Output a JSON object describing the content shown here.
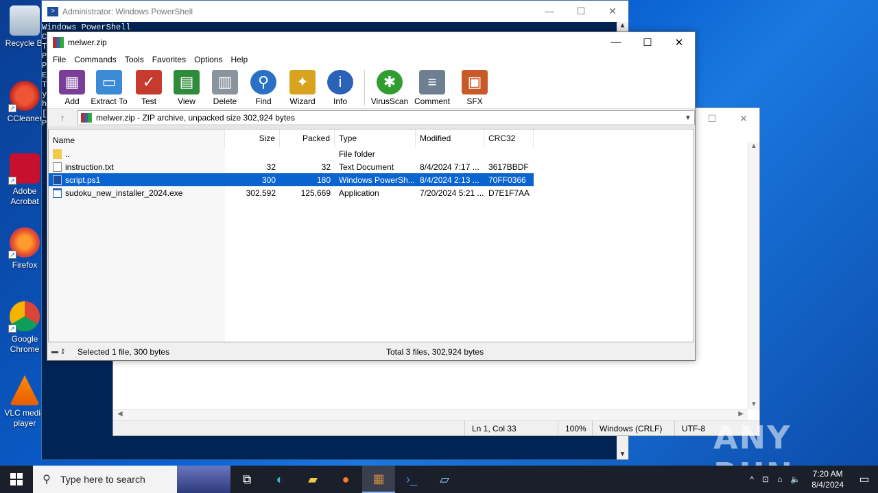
{
  "desktop": {
    "icons": [
      {
        "label": "Recycle Bi",
        "icon": "recycle-bin-icon"
      },
      {
        "label": "CCleaner",
        "icon": "ccleaner-icon"
      },
      {
        "label": "Adobe Acrobat",
        "icon": "adobe-acrobat-icon"
      },
      {
        "label": "Firefox",
        "icon": "firefox-icon"
      },
      {
        "label": "Google Chrome",
        "icon": "chrome-icon"
      },
      {
        "label": "VLC media player",
        "icon": "vlc-icon"
      }
    ]
  },
  "powershell": {
    "title": "Administrator: Windows PowerShell",
    "first_line": "Windows PowerShell",
    "side_chars": [
      "C",
      "T",
      "P",
      "E",
      "T",
      "y",
      "h",
      "[",
      "P"
    ]
  },
  "notepad": {
    "status": {
      "position": "Ln 1, Col 33",
      "zoom": "100%",
      "line_ending": "Windows (CRLF)",
      "encoding": "UTF-8"
    }
  },
  "winrar": {
    "title": "melwer.zip",
    "menu": [
      "File",
      "Commands",
      "Tools",
      "Favorites",
      "Options",
      "Help"
    ],
    "toolbar": [
      {
        "label": "Add",
        "icon": "add-icon",
        "color": "#7a3d9a"
      },
      {
        "label": "Extract To",
        "icon": "extract-folder-icon",
        "color": "#3a8ad6"
      },
      {
        "label": "Test",
        "icon": "test-clipboard-icon",
        "color": "#c73b2e"
      },
      {
        "label": "View",
        "icon": "view-book-icon",
        "color": "#2e8b3a"
      },
      {
        "label": "Delete",
        "icon": "delete-bin-icon",
        "color": "#8a949e"
      },
      {
        "label": "Find",
        "icon": "find-magnifier-icon",
        "color": "#2a70c4"
      },
      {
        "label": "Wizard",
        "icon": "wizard-wand-icon",
        "color": "#d8a420"
      },
      {
        "label": "Info",
        "icon": "info-icon",
        "color": "#2a62b8"
      },
      {
        "label": "VirusScan",
        "icon": "virusscan-icon",
        "color": "#2f9e2f"
      },
      {
        "label": "Comment",
        "icon": "comment-icon",
        "color": "#6f7f92"
      },
      {
        "label": "SFX",
        "icon": "sfx-icon",
        "color": "#c85a2a"
      }
    ],
    "address": "melwer.zip - ZIP archive, unpacked size 302,924 bytes",
    "columns": {
      "name": "Name",
      "size": "Size",
      "packed": "Packed",
      "type": "Type",
      "modified": "Modified",
      "crc": "CRC32"
    },
    "rows": [
      {
        "name": "..",
        "size": "",
        "packed": "",
        "type": "File folder",
        "modified": "",
        "crc": "",
        "kind": "folder"
      },
      {
        "name": "instruction.txt",
        "size": "32",
        "packed": "32",
        "type": "Text Document",
        "modified": "8/4/2024 7:17 ...",
        "crc": "3617BBDF",
        "kind": "txt"
      },
      {
        "name": "script.ps1",
        "size": "300",
        "packed": "180",
        "type": "Windows PowerSh...",
        "modified": "8/4/2024 2:13 ...",
        "crc": "70FF0366",
        "kind": "ps1",
        "selected": true
      },
      {
        "name": "sudoku_new_installer_2024.exe",
        "size": "302,592",
        "packed": "125,669",
        "type": "Application",
        "modified": "7/20/2024 5:21 ...",
        "crc": "D7E1F7AA",
        "kind": "exe"
      }
    ],
    "status_left": "Selected 1 file, 300 bytes",
    "status_right": "Total 3 files, 302,924 bytes"
  },
  "taskbar": {
    "search_placeholder": "Type here to search",
    "apps": [
      "task-view-icon",
      "edge-icon",
      "file-explorer-icon",
      "firefox-icon",
      "winrar-icon",
      "powershell-icon",
      "notepad-icon"
    ],
    "time": "7:20 AM",
    "date": "8/4/2024"
  },
  "watermark": "ANY RUN"
}
